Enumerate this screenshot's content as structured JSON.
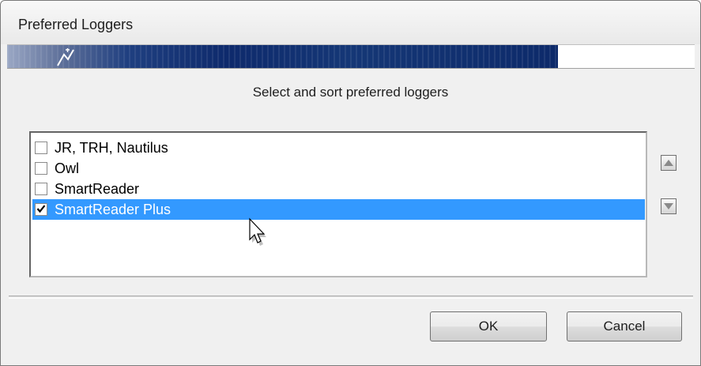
{
  "window": {
    "title": "Preferred Loggers"
  },
  "instruction": "Select and sort preferred loggers",
  "loggers": [
    {
      "label": "JR, TRH, Nautilus",
      "checked": false,
      "selected": false
    },
    {
      "label": "Owl",
      "checked": false,
      "selected": false
    },
    {
      "label": "SmartReader",
      "checked": false,
      "selected": false
    },
    {
      "label": "SmartReader Plus",
      "checked": true,
      "selected": true
    }
  ],
  "sort_buttons": {
    "up_icon": "triangle-up-icon",
    "down_icon": "triangle-down-icon"
  },
  "buttons": {
    "ok": "OK",
    "cancel": "Cancel"
  },
  "colors": {
    "selection": "#3399ff",
    "banner": "#0e2a6c"
  }
}
